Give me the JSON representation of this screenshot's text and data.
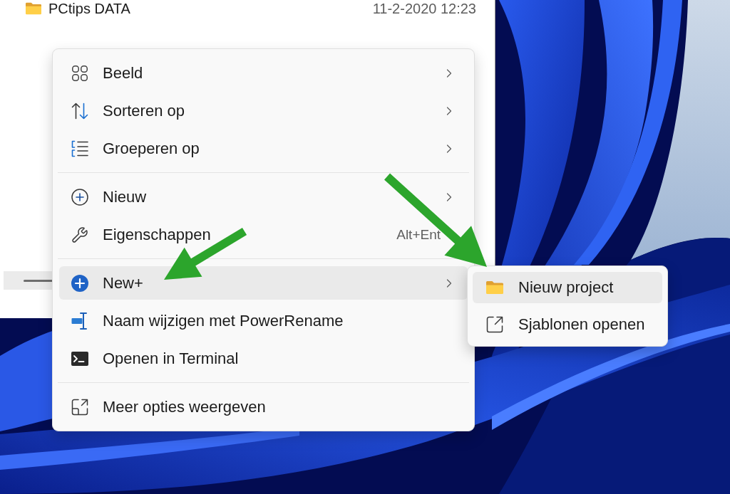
{
  "explorer": {
    "file": {
      "name": "PCtips DATA",
      "modified": "11-2-2020 12:23"
    }
  },
  "context_menu": {
    "sections": [
      {
        "items": [
          {
            "label": "Beeld",
            "submenu": true,
            "selected": false
          },
          {
            "label": "Sorteren op",
            "submenu": true,
            "selected": false
          },
          {
            "label": "Groeperen op",
            "submenu": true,
            "selected": false
          }
        ]
      },
      {
        "items": [
          {
            "label": "Nieuw",
            "submenu": true,
            "selected": false
          },
          {
            "label": "Eigenschappen",
            "submenu": false,
            "selected": false,
            "shortcut": "Alt+Ent"
          }
        ]
      },
      {
        "items": [
          {
            "label": "New+",
            "submenu": true,
            "selected": true
          },
          {
            "label": "Naam wijzigen met PowerRename",
            "submenu": false,
            "selected": false
          },
          {
            "label": "Openen in Terminal",
            "submenu": false,
            "selected": false
          }
        ]
      },
      {
        "items": [
          {
            "label": "Meer opties weergeven",
            "submenu": false,
            "selected": false
          }
        ]
      }
    ]
  },
  "submenu": {
    "items": [
      {
        "label": "Nieuw project",
        "selected": true
      },
      {
        "label": "Sjablonen openen",
        "selected": false
      }
    ]
  }
}
